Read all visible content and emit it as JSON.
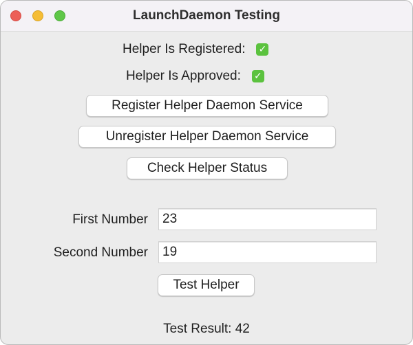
{
  "window": {
    "title": "LaunchDaemon Testing"
  },
  "status": {
    "registered_label": "Helper Is Registered:",
    "registered_value": "✓",
    "approved_label": "Helper Is Approved:",
    "approved_value": "✓"
  },
  "buttons": {
    "register": "Register Helper Daemon Service",
    "unregister": "Unregister Helper Daemon Service",
    "check_status": "Check Helper Status",
    "test_helper": "Test Helper"
  },
  "form": {
    "first_label": "First Number",
    "first_value": "23",
    "second_label": "Second Number",
    "second_value": "19"
  },
  "result": {
    "text": "Test Result: 42"
  },
  "colors": {
    "check_green": "#5bc23e",
    "close": "#ec5f58",
    "minimize": "#f5bd35",
    "maximize": "#5fc748"
  }
}
